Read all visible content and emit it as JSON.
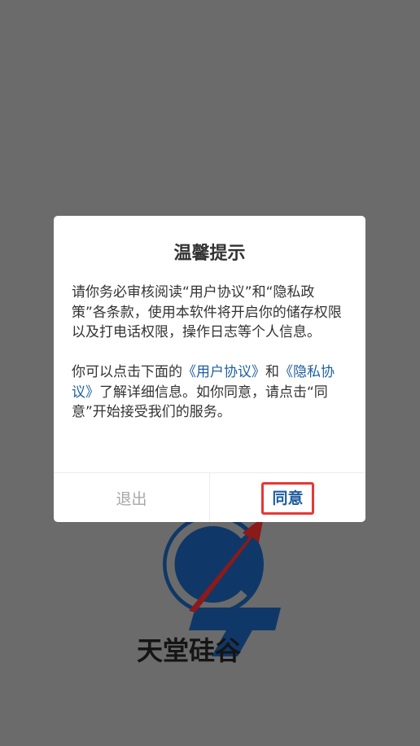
{
  "dialog": {
    "title": "温馨提示",
    "para1": "请你务必审核阅读“用户协议”和“隐私政策”各条款，使用本软件将开启你的储存权限以及打电话权限，操作日志等个人信息。",
    "para2_prefix": "你可以点击下面的",
    "link_user": "《用户协议》",
    "para2_and": "和",
    "link_privacy": "《隐私协议》",
    "para2_suffix": "了解详细信息。如你同意，请点击“同意”开始接受我们的服务。",
    "exit_label": "退出",
    "agree_label": "同意"
  },
  "logo": {
    "text": "天堂硅谷"
  },
  "colors": {
    "overlay": "#6b6b6b",
    "link": "#1f5fa0",
    "agree": "#1e5c9e",
    "exit": "#a7a7a7",
    "highlight": "#e53935",
    "arrow": "#8b1a1a"
  }
}
